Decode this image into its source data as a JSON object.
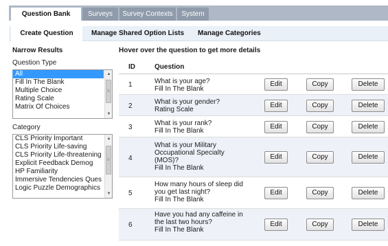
{
  "top_tabs": [
    "Question Bank",
    "Surveys",
    "Survey Contexts",
    "System"
  ],
  "sub_nav": [
    "Create Question",
    "Manage Shared Option Lists",
    "Manage Categories"
  ],
  "left_panel": {
    "title": "Narrow Results",
    "question_type_label": "Question Type",
    "question_types": [
      "All",
      "Fill In The Blank",
      "Multiple Choice",
      "Rating Scale",
      "Matrix Of Choices"
    ],
    "category_label": "Category",
    "categories": [
      "CLS Priority Important",
      "CLS Priority Life-saving",
      "CLS Priority Life-threatening",
      "Explicit Feedback Demog",
      "HP Familiarity",
      "Immersive Tendencies Ques",
      "Logic Puzzle Demographics"
    ]
  },
  "main": {
    "hint": "Hover over the question to get more details",
    "headers": {
      "id": "ID",
      "question": "Question"
    },
    "buttons": {
      "edit": "Edit",
      "copy": "Copy",
      "delete": "Delete"
    },
    "rows": [
      {
        "id": "1",
        "question": "What is your age?",
        "type": "Fill In The Blank"
      },
      {
        "id": "2",
        "question": "What is your gender?",
        "type": "Rating Scale"
      },
      {
        "id": "3",
        "question": "What is your rank?",
        "type": "Fill In The Blank"
      },
      {
        "id": "4",
        "question": "What is your Military Occupational Specialty (MOS)?",
        "type": "Fill In The Blank"
      },
      {
        "id": "5",
        "question": "How many hours of sleep did you get last night?",
        "type": "Fill In The Blank"
      },
      {
        "id": "6",
        "question": "Have you had any caffeine in the last two hours?",
        "type": "Fill In The Blank"
      }
    ]
  }
}
